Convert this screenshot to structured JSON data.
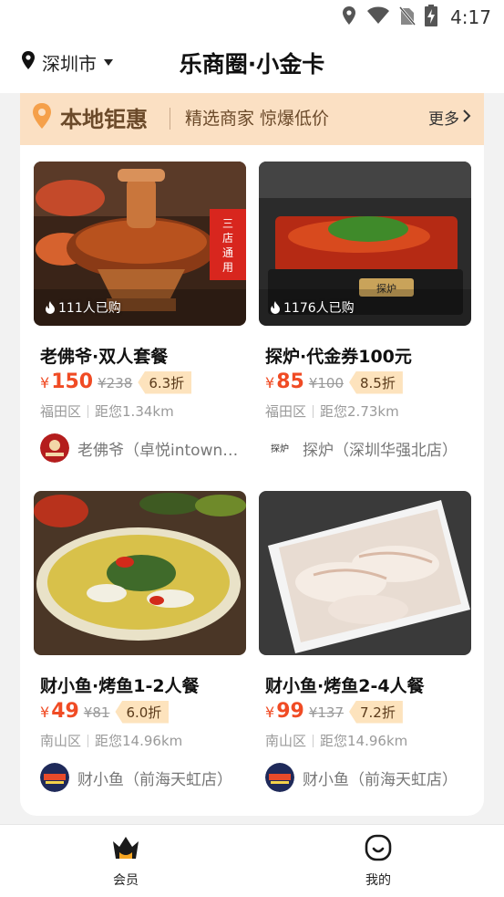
{
  "status_bar": {
    "time": "4:17",
    "icons": [
      "location-icon",
      "wifi-icon",
      "no-sim-icon",
      "battery-charging-icon"
    ]
  },
  "header": {
    "city": "深圳市",
    "title": "乐商圈·小金卡"
  },
  "promo": {
    "title": "本地钜惠",
    "subtitle": "精选商家 惊爆低价",
    "more_label": "更多"
  },
  "deals": [
    {
      "title": "老佛爷·双人套餐",
      "price": "150",
      "currency": "¥",
      "original_price": "¥238",
      "discount": "6.3折",
      "district": "福田区",
      "distance": "距您1.34km",
      "merchant": "老佛爷（卓悦intown…",
      "sold": "111人已购",
      "badge": "三店通用"
    },
    {
      "title": "探炉·代金券100元",
      "price": "85",
      "currency": "¥",
      "original_price": "¥100",
      "discount": "8.5折",
      "district": "福田区",
      "distance": "距您2.73km",
      "merchant": "探炉（深圳华强北店）",
      "sold": "1176人已购",
      "logo_text": "探炉"
    },
    {
      "title": "财小鱼·烤鱼1-2人餐",
      "price": "49",
      "currency": "¥",
      "original_price": "¥81",
      "discount": "6.0折",
      "district": "南山区",
      "distance": "距您14.96km",
      "merchant": "财小鱼（前海天虹店）"
    },
    {
      "title": "财小鱼·烤鱼2-4人餐",
      "price": "99",
      "currency": "¥",
      "original_price": "¥137",
      "discount": "7.2折",
      "district": "南山区",
      "distance": "距您14.96km",
      "merchant": "财小鱼（前海天虹店）"
    }
  ],
  "tabbar": {
    "tabs": [
      {
        "label": "会员",
        "icon": "crown-icon",
        "active": true
      },
      {
        "label": "我的",
        "icon": "smile-icon",
        "active": false
      }
    ]
  },
  "colors": {
    "price": "#f04b24",
    "promo_bg": "#fbe0c3",
    "accent": "#f5a623"
  }
}
